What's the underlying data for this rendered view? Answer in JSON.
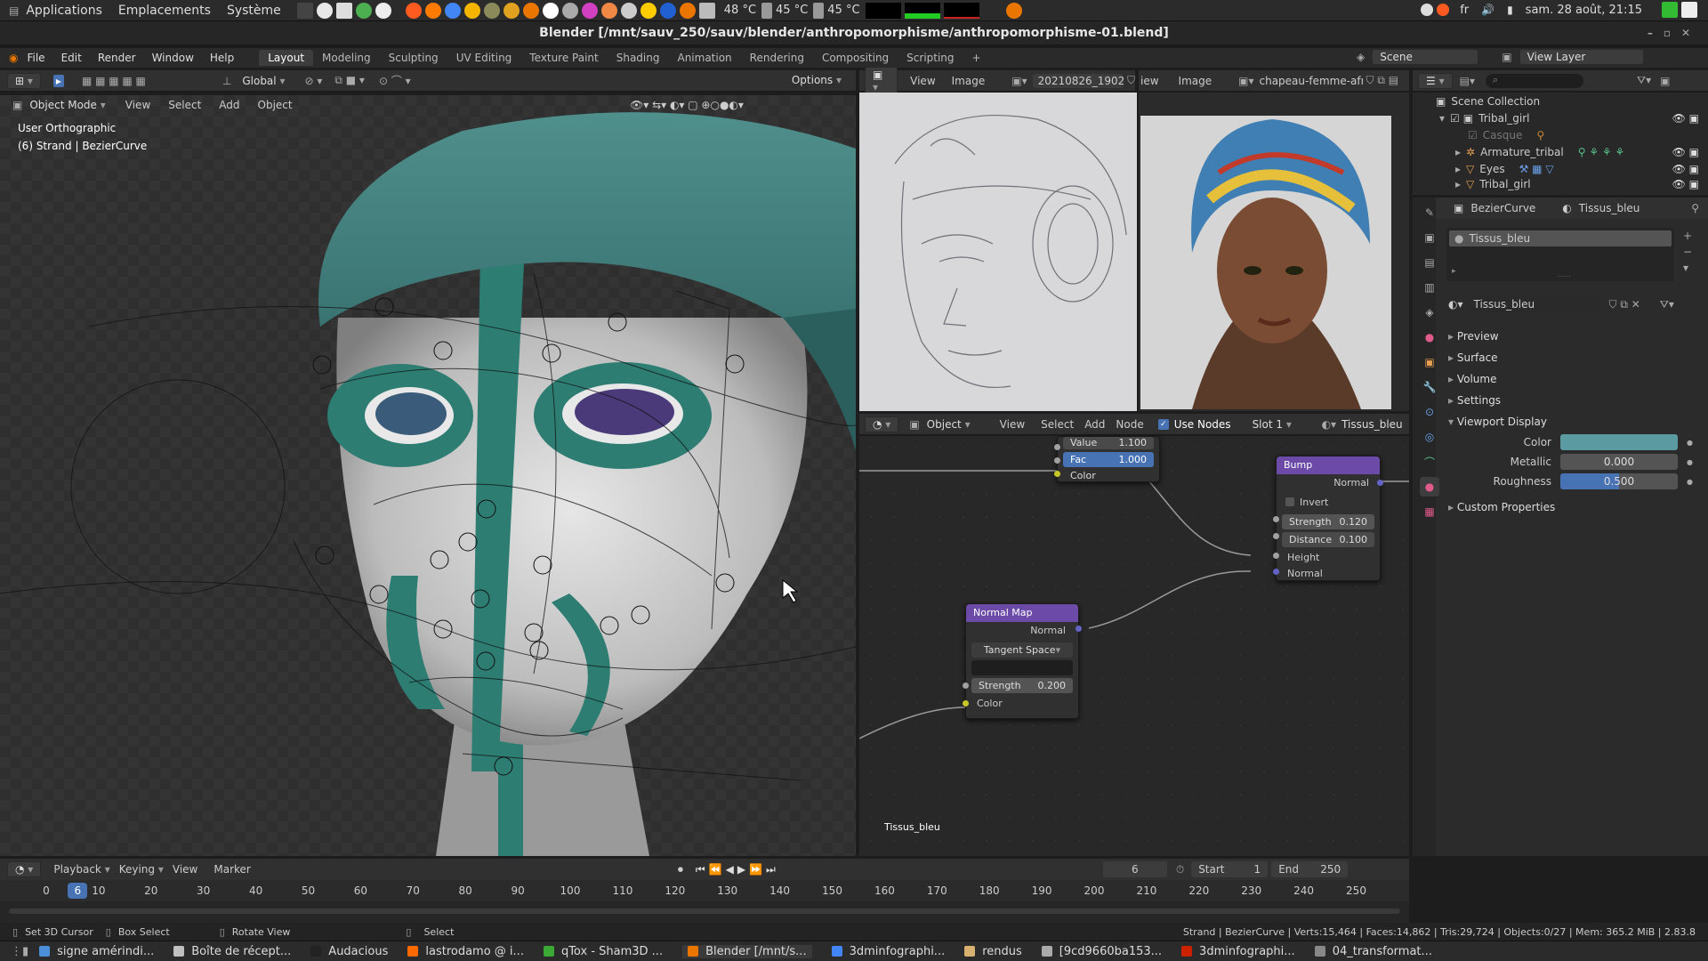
{
  "sysbar": {
    "menus": [
      "Applications",
      "Emplacements",
      "Système"
    ],
    "temps": [
      "48 °C",
      "45 °C",
      "45 °C"
    ],
    "lang": "fr",
    "clock": "sam. 28 août, 21:15"
  },
  "window": {
    "title": "Blender [/mnt/sauv_250/sauv/blender/anthropomorphisme/anthropomorphisme-01.blend]"
  },
  "menubar": {
    "menus": [
      "File",
      "Edit",
      "Render",
      "Window",
      "Help"
    ],
    "workspaces": [
      "Layout",
      "Modeling",
      "Sculpting",
      "UV Editing",
      "Texture Paint",
      "Shading",
      "Animation",
      "Rendering",
      "Compositing",
      "Scripting"
    ],
    "active_workspace": "Layout",
    "scene": "Scene",
    "view_layer": "View Layer"
  },
  "viewport": {
    "orientation": "Global",
    "options": "Options",
    "mode": "Object Mode",
    "menus": [
      "View",
      "Select",
      "Add",
      "Object"
    ],
    "view_name": "User Orthographic",
    "object_info": "(6) Strand | BezierCurve"
  },
  "image_editor": {
    "left": {
      "menus": [
        "View",
        "Image"
      ],
      "image_name": "20210826_19024..."
    },
    "right": {
      "menus": [
        "iew",
        "Image"
      ],
      "image_name": "chapeau-femme-afri..."
    }
  },
  "node_editor": {
    "object": "Object",
    "menus": [
      "View",
      "Select",
      "Add",
      "Node"
    ],
    "use_nodes": "Use Nodes",
    "slot": "Slot 1",
    "material": "Tissus_bleu",
    "footer_label": "Tissus_bleu",
    "mix_node": {
      "value_label": "Value",
      "value": "1.100",
      "fac_label": "Fac",
      "fac": "1.000",
      "color_label": "Color"
    },
    "bump_node": {
      "title": "Bump",
      "out_normal": "Normal",
      "invert": "Invert",
      "strength_label": "Strength",
      "strength": "0.120",
      "distance_label": "Distance",
      "distance": "0.100",
      "in_height": "Height",
      "in_normal": "Normal"
    },
    "normal_map_node": {
      "title": "Normal Map",
      "out_normal": "Normal",
      "space": "Tangent Space",
      "strength_label": "Strength",
      "strength": "0.200",
      "in_color": "Color"
    }
  },
  "outliner": {
    "root": "Scene Collection",
    "items": [
      {
        "label": "Tribal_girl",
        "indent": 1
      },
      {
        "label": "Casque",
        "indent": 2
      },
      {
        "label": "Armature_tribal",
        "indent": 2
      },
      {
        "label": "Eyes",
        "indent": 2
      },
      {
        "label": "Tribal_girl",
        "indent": 2
      }
    ]
  },
  "properties": {
    "object": "BezierCurve",
    "material": "Tissus_bleu",
    "slot_item": "Tissus_bleu",
    "material_field": "Tissus_bleu",
    "sections": [
      "Preview",
      "Surface",
      "Volume",
      "Settings"
    ],
    "viewport_display": "Viewport Display",
    "color_label": "Color",
    "color_value": "#5a9aa0",
    "metallic_label": "Metallic",
    "metallic": "0.000",
    "roughness_label": "Roughness",
    "roughness": "0.500",
    "roughness_fraction": 0.5,
    "custom_properties": "Custom Properties"
  },
  "timeline": {
    "menus": [
      "Playback",
      "Keying",
      "View",
      "Marker"
    ],
    "current_frame": "6",
    "start_label": "Start",
    "start": "1",
    "end_label": "End",
    "end": "250",
    "ticks": [
      "0",
      "10",
      "20",
      "30",
      "40",
      "50",
      "60",
      "70",
      "80",
      "90",
      "100",
      "110",
      "120",
      "130",
      "140",
      "150",
      "160",
      "170",
      "180",
      "190",
      "200",
      "210",
      "220",
      "230",
      "240",
      "250"
    ]
  },
  "status": {
    "hints": [
      "Set 3D Cursor",
      "Box Select",
      "Rotate View",
      "Select"
    ],
    "stats": "Strand | BezierCurve | Verts:15,464 | Faces:14,862 | Tris:29,724 | Objects:0/27 | Mem: 365.2 MiB | 2.83.8"
  },
  "taskbar": {
    "tasks": [
      {
        "label": "signe amérindi...",
        "color": "#4a8fd8"
      },
      {
        "label": "Boîte de récept...",
        "color": "#c0c0c0"
      },
      {
        "label": "Audacious",
        "color": "#222222"
      },
      {
        "label": "lastrodamo @ i...",
        "color": "#ff6a00"
      },
      {
        "label": "qTox - Sham3D ...",
        "color": "#3aaa35"
      },
      {
        "label": "Blender [/mnt/s...",
        "color": "#ea7600"
      },
      {
        "label": "3dminfographi...",
        "color": "#4285f4"
      },
      {
        "label": "rendus",
        "color": "#d8b070"
      },
      {
        "label": "[9cd9660ba153...",
        "color": "#aaaaaa"
      },
      {
        "label": "3dminfographi...",
        "color": "#cc2200"
      },
      {
        "label": "04_transformat...",
        "color": "#888888"
      }
    ],
    "active_index": 5
  }
}
